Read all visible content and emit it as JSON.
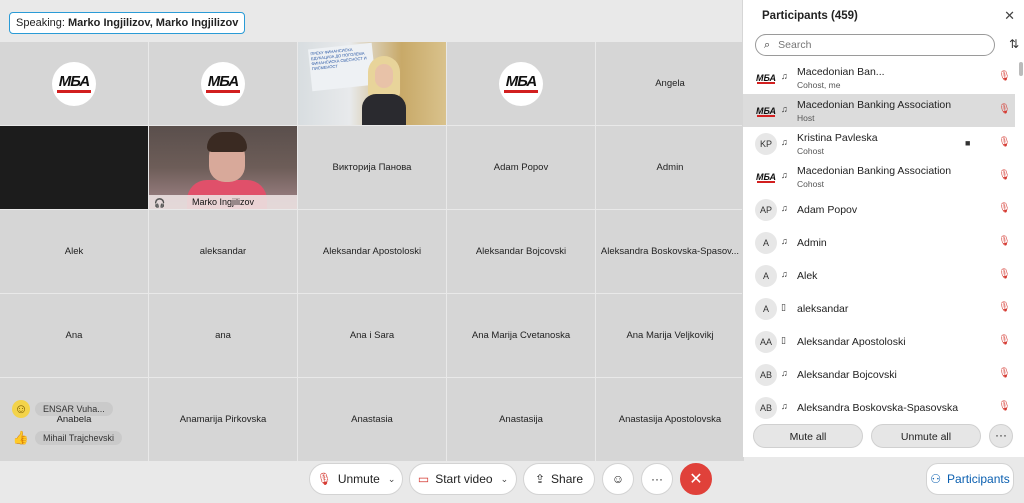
{
  "speaking": {
    "label": "Speaking:",
    "names": "Marko Ingjilizov, Marko Ingjilizov"
  },
  "grid": {
    "tiles": [
      {
        "kind": "logo",
        "name": ""
      },
      {
        "kind": "logo",
        "name": ""
      },
      {
        "kind": "video-office",
        "name": ""
      },
      {
        "kind": "logo",
        "name": ""
      },
      {
        "kind": "name",
        "name": "Angela"
      },
      {
        "kind": "dark",
        "name": ""
      },
      {
        "kind": "video-cam",
        "name": "Marko Ingjilizov"
      },
      {
        "kind": "name",
        "name": "Викторија Панова"
      },
      {
        "kind": "name",
        "name": "Adam Popov"
      },
      {
        "kind": "name",
        "name": "Admin"
      },
      {
        "kind": "name",
        "name": "Alek"
      },
      {
        "kind": "name",
        "name": "aleksandar"
      },
      {
        "kind": "name",
        "name": "Aleksandar Apostoloski"
      },
      {
        "kind": "name",
        "name": "Aleksandar Bojcovski"
      },
      {
        "kind": "name",
        "name": "Aleksandra Boskovska-Spasov..."
      },
      {
        "kind": "name",
        "name": "Ana"
      },
      {
        "kind": "name",
        "name": "ana"
      },
      {
        "kind": "name",
        "name": "Ana i Sara"
      },
      {
        "kind": "name",
        "name": "Ana Marija Cvetanoska"
      },
      {
        "kind": "name",
        "name": "Ana Marija Veljkovikj"
      },
      {
        "kind": "name",
        "name": "Anabela"
      },
      {
        "kind": "name",
        "name": "Anamarija Pirkovska"
      },
      {
        "kind": "name",
        "name": "Anastasia"
      },
      {
        "kind": "name",
        "name": "Anastasija"
      },
      {
        "kind": "name",
        "name": "Anastasija Apostolovska"
      }
    ],
    "logo_text": "МБА",
    "office_sign": "ПРЕКУ ФИНАНСИСКА ЕДУКАЦИЈА ДО ПОГОЛЕМА ФИНАНСИСКА СВЕСНОСТ И ПИСМЕНОСТ"
  },
  "reactions": [
    {
      "emoji": "☺",
      "name": "ENSAR Vuha..."
    },
    {
      "emoji": "👍",
      "name": "Mihail Trajchevski"
    }
  ],
  "controls": {
    "unmute": "Unmute",
    "start_video": "Start video",
    "share": "Share",
    "participants": "Participants"
  },
  "panel": {
    "title": "Participants (459)",
    "search_placeholder": "Search",
    "participants": [
      {
        "avatar": "МБА",
        "logo": true,
        "device": "headset",
        "name": "Macedonian Ban...",
        "role": "Cohost, me",
        "video": false
      },
      {
        "avatar": "МБА",
        "logo": true,
        "device": "headset",
        "name": "Macedonian Banking Association",
        "role": "Host",
        "video": false,
        "selected": true
      },
      {
        "avatar": "KP",
        "logo": false,
        "device": "headset",
        "name": "Kristina Pavleska",
        "role": "Cohost",
        "video": true
      },
      {
        "avatar": "МБА",
        "logo": true,
        "device": "headset",
        "name": "Macedonian Banking Association",
        "role": "Cohost",
        "video": false
      },
      {
        "avatar": "AP",
        "logo": false,
        "device": "headset",
        "name": "Adam Popov",
        "role": "",
        "video": false
      },
      {
        "avatar": "A",
        "logo": false,
        "device": "headset",
        "name": "Admin",
        "role": "",
        "video": false
      },
      {
        "avatar": "A",
        "logo": false,
        "device": "headset",
        "name": "Alek",
        "role": "",
        "video": false
      },
      {
        "avatar": "A",
        "logo": false,
        "device": "phone",
        "name": "aleksandar",
        "role": "",
        "video": false
      },
      {
        "avatar": "AA",
        "logo": false,
        "device": "phone",
        "name": "Aleksandar Apostoloski",
        "role": "",
        "video": false
      },
      {
        "avatar": "AB",
        "logo": false,
        "device": "headset",
        "name": "Aleksandar Bojcovski",
        "role": "",
        "video": false
      },
      {
        "avatar": "AB",
        "logo": false,
        "device": "headset",
        "name": "Aleksandra Boskovska-Spasovska",
        "role": "",
        "video": false
      }
    ],
    "mute_all": "Mute all",
    "unmute_all": "Unmute all"
  },
  "colors": {
    "accent": "#1aa0e6",
    "leave": "#e0413a",
    "muted": "#d53a32"
  }
}
